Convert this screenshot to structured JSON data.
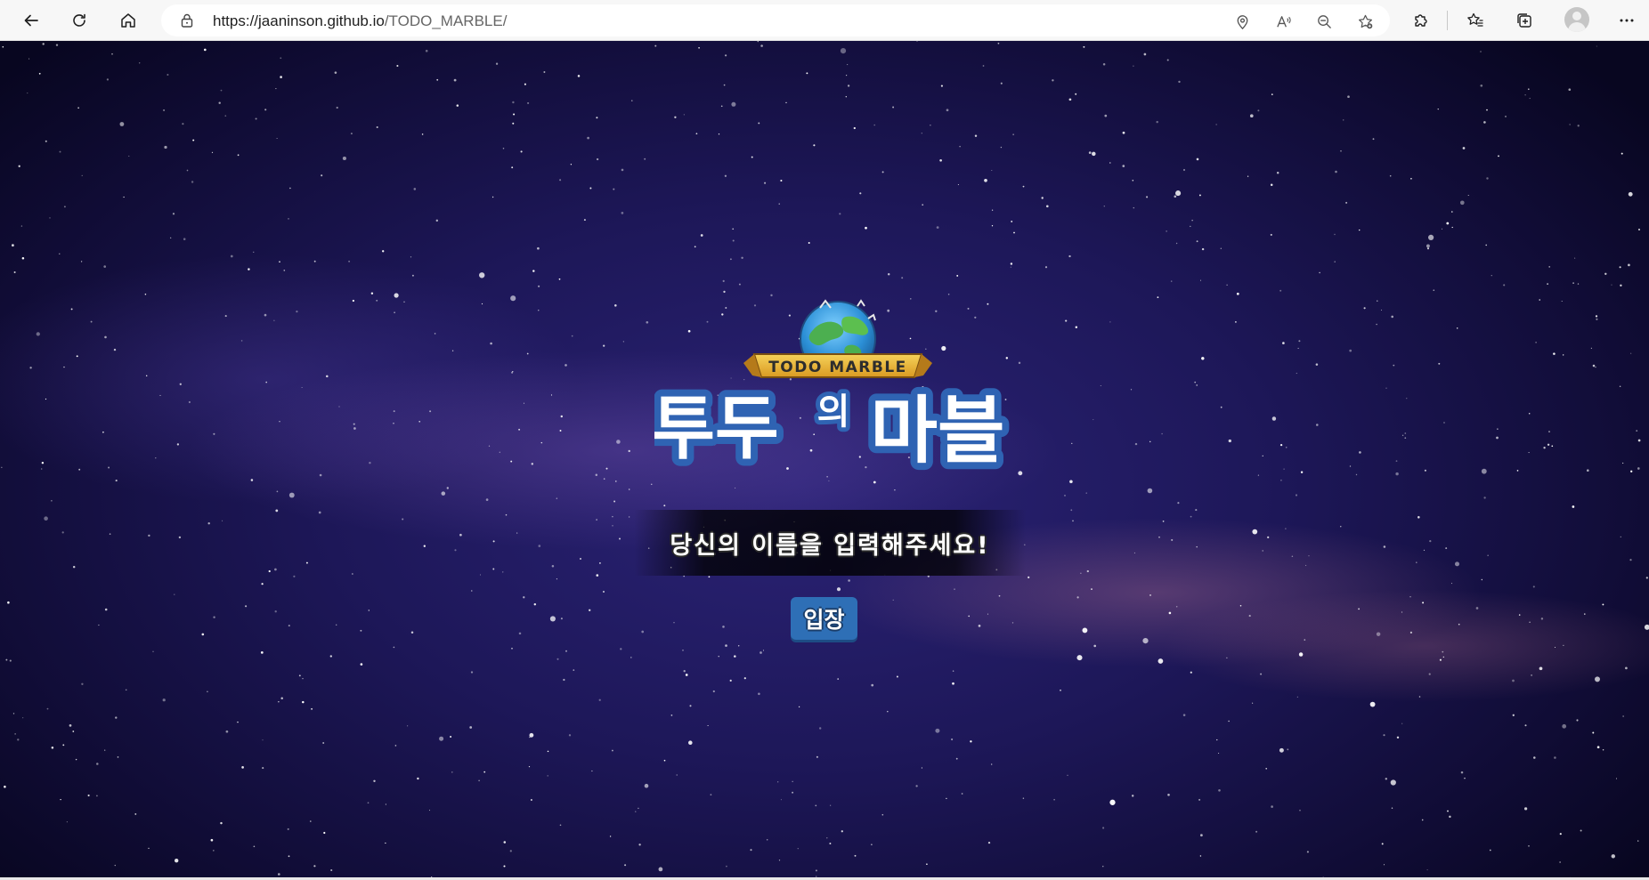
{
  "browser": {
    "url_host": "https://jaaninson.github.io",
    "url_path": "/TODO_MARBLE/"
  },
  "logo": {
    "banner_text": "TODO MARBLE",
    "title_part1": "투두",
    "title_part2": "의",
    "title_part3": "마블"
  },
  "main": {
    "prompt": "당신의 이름을 입력해주세요!",
    "enter_button": "입장"
  },
  "colors": {
    "button": "#2e6fb6",
    "logo_text_outline": "#2f63b3",
    "banner": "#e9b33a"
  }
}
